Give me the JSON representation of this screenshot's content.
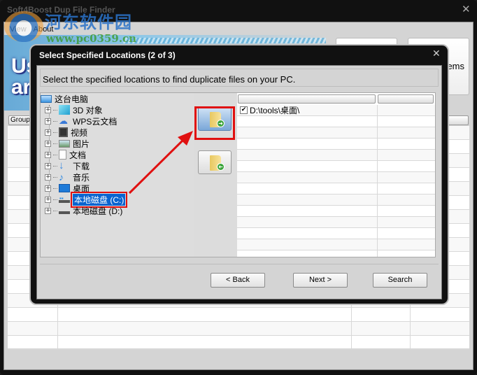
{
  "app": {
    "title": "Soft4Boost Dup File Finder",
    "close": "✕",
    "menu": [
      "View",
      "About"
    ],
    "banner_text": [
      "Us",
      "ar"
    ],
    "top_button_partial_label": "ems",
    "group_header": "Group"
  },
  "watermark": {
    "name": "河东软件园",
    "url": "www.pc0359.cn"
  },
  "dialog": {
    "title": "Select Specified Locations (2 of 3)",
    "close": "✕",
    "instruction": "Select the specified locations to find duplicate files on your PC.",
    "tree": {
      "root": {
        "label": "这台电脑",
        "icon": "computer-icon"
      },
      "items": [
        {
          "label": "3D 对象",
          "icon": "3d-objects-icon"
        },
        {
          "label": "WPS云文档",
          "icon": "cloud-icon"
        },
        {
          "label": "视频",
          "icon": "video-icon"
        },
        {
          "label": "图片",
          "icon": "pictures-icon"
        },
        {
          "label": "文档",
          "icon": "document-icon"
        },
        {
          "label": "下载",
          "icon": "download-icon"
        },
        {
          "label": "音乐",
          "icon": "music-icon"
        },
        {
          "label": "桌面",
          "icon": "desktop-icon"
        },
        {
          "label": "本地磁盘 (C:)",
          "icon": "drive-c-icon",
          "selected": true
        },
        {
          "label": "本地磁盘 (D:)",
          "icon": "drive-d-icon"
        }
      ]
    },
    "add_button_icon": "folder-add-icon",
    "remove_button_icon": "folder-remove-icon",
    "locations": [
      {
        "path": "D:\\tools\\桌面\\",
        "checked": true
      }
    ],
    "buttons": {
      "back": "< Back",
      "next": "Next >",
      "search": "Search"
    }
  },
  "annotation_color": "#e01010",
  "selection_color": "#0a64d0"
}
